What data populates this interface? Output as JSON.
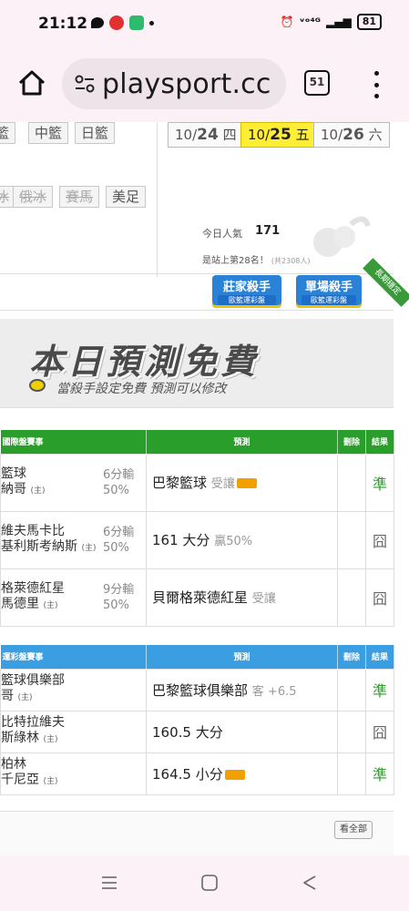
{
  "status": {
    "time": "21:12",
    "net": "ᵛᵒ⁴ᴳ",
    "battery": "81"
  },
  "browser": {
    "url": "playsport.cc",
    "tab_count": "51"
  },
  "filters": {
    "league_chips": [
      "籃",
      "中籃",
      "日籃"
    ],
    "sport_chips": [
      {
        "label": "冰",
        "disabled": true
      },
      {
        "label": "俄冰",
        "disabled": true
      },
      {
        "label": "賽馬",
        "disabled": true
      },
      {
        "label": "美足",
        "disabled": false
      }
    ]
  },
  "dates": [
    {
      "md": "10/",
      "day": "24",
      "wd": "四",
      "selected": false
    },
    {
      "md": "10/",
      "day": "25",
      "wd": "五",
      "selected": true
    },
    {
      "md": "10/",
      "day": "26",
      "wd": "六",
      "selected": false
    }
  ],
  "popularity": {
    "label": "今日人氣",
    "value": "171",
    "rank": "是站上第28名！",
    "rank_small": "(共2308人)"
  },
  "badges": {
    "b1": "莊家殺手",
    "b1_sub": "歐籃運彩盤",
    "b2": "單場殺手",
    "b2_sub": "歐籃運彩盤",
    "ribbon": "長期穩定"
  },
  "banner": {
    "title": "本日預測免費",
    "subtitle": "當殺手設定免費 預測可以修改"
  },
  "intl_table": {
    "headers": [
      "國際盤賽事",
      "預測",
      "刪除",
      "結果"
    ],
    "rows": [
      {
        "away": "籃球",
        "home": "納哥",
        "home_tag": "(主)",
        "hc1": "6分輸",
        "hc2": "50%",
        "pred": "巴黎籃球",
        "tag": "受讓",
        "badge": true,
        "result": "準",
        "hit": true
      },
      {
        "away": "維夫馬卡比",
        "home": "基利斯考納斯",
        "home_tag": "(主)",
        "hc1": "6分輸",
        "hc2": "50%",
        "pred": "161 大分",
        "tag": "贏50%",
        "badge": false,
        "result": "囧",
        "hit": false
      },
      {
        "away": "格萊德紅星",
        "home": "馬德里",
        "home_tag": "(主)",
        "hc1": "9分輸",
        "hc2": "50%",
        "pred": "貝爾格萊德紅星",
        "tag": "受讓",
        "badge": false,
        "result": "囧",
        "hit": false
      }
    ]
  },
  "lottery_table": {
    "headers": [
      "運彩盤賽事",
      "預測",
      "刪除",
      "結果"
    ],
    "rows": [
      {
        "away": "籃球俱樂部",
        "home": "哥",
        "home_tag": "(主)",
        "pred": "巴黎籃球俱樂部",
        "tag": "客 +6.5",
        "badge": false,
        "result": "準",
        "hit": true
      },
      {
        "away": "比特拉維夫",
        "home": "斯綠林",
        "home_tag": "(主)",
        "pred": "160.5 大分",
        "tag": "",
        "badge": false,
        "result": "囧",
        "hit": false
      },
      {
        "away": "柏林",
        "home": "千尼亞",
        "home_tag": "(主)",
        "pred": "164.5 小分",
        "tag": "",
        "badge": true,
        "result": "準",
        "hit": true
      }
    ]
  },
  "bottom": {
    "see_all": "看全部"
  }
}
